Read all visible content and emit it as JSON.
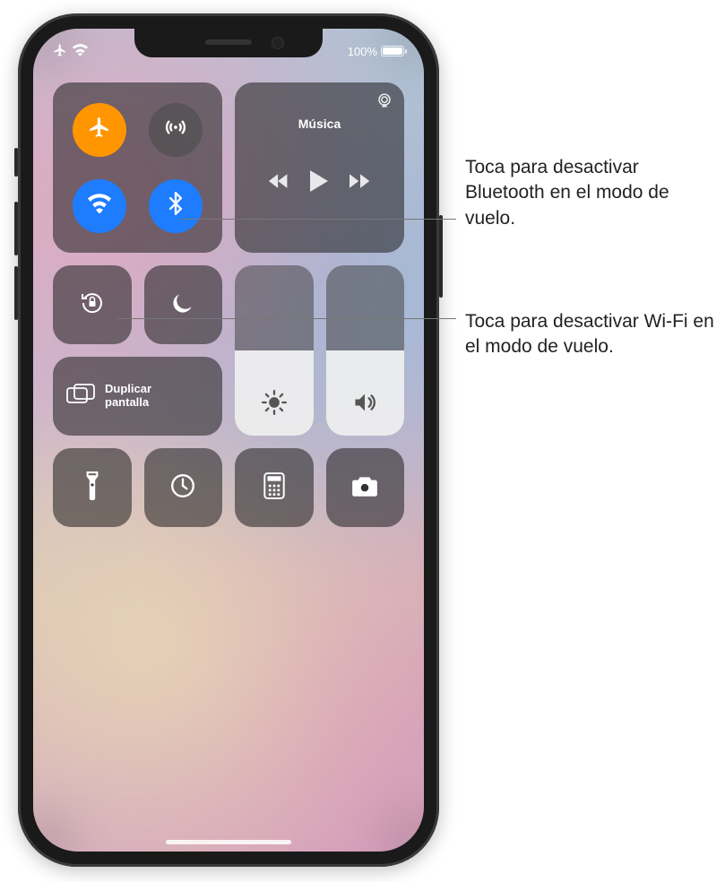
{
  "status": {
    "battery_percent": "100%"
  },
  "connectivity": {
    "airplane": true,
    "cellular": false,
    "wifi": true,
    "bluetooth": true
  },
  "music": {
    "title": "Música"
  },
  "mirror": {
    "label_line1": "Duplicar",
    "label_line2": "pantalla"
  },
  "sliders": {
    "brightness_pct": 50,
    "volume_pct": 50
  },
  "callouts": {
    "bluetooth": "Toca para desactivar Bluetooth en el modo de vuelo.",
    "wifi": "Toca para desactivar Wi-Fi en el modo de vuelo."
  }
}
